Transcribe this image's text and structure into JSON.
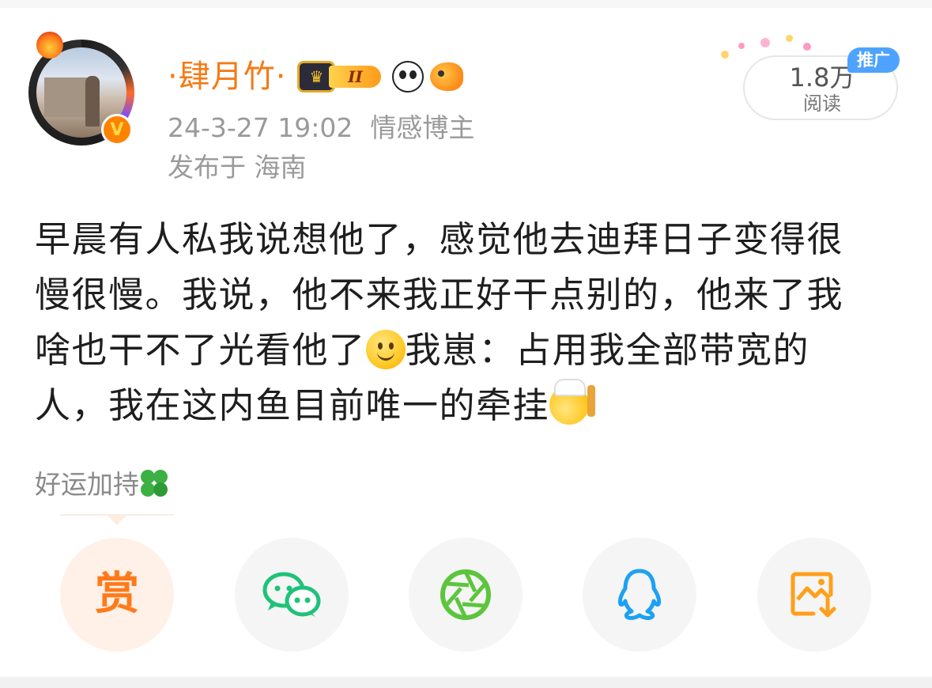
{
  "header": {
    "user_name": "·肆月竹·",
    "level_badge": "II",
    "timestamp": "24-3-27 19:02",
    "user_tag": "情感博主",
    "location": "发布于 海南"
  },
  "reads": {
    "count": "1.8万",
    "label": "阅读",
    "promo_tag": "推广"
  },
  "post": {
    "lines": [
      "早晨有人私我说想他了，感觉他去迪拜日子变得很",
      "慢很慢。我说，他不来我正好干点别的，他来了我",
      "啥也干不了光看他了",
      "我崽：占用我全部带宽的",
      "人，我在这内鱼目前唯一的牵挂"
    ]
  },
  "tag": {
    "text": "好运加持"
  },
  "share": {
    "reward_label": "赏",
    "icons": [
      "reward-icon",
      "wechat-icon",
      "moments-icon",
      "qq-icon",
      "save-image-icon"
    ]
  },
  "colors": {
    "accent_orange": "#f57a16",
    "promo_blue": "#4da3ff",
    "wechat_green": "#1fc279",
    "moments_green": "#5cc53d",
    "qq_blue": "#1da1f2",
    "save_orange": "#ff9f1a"
  }
}
